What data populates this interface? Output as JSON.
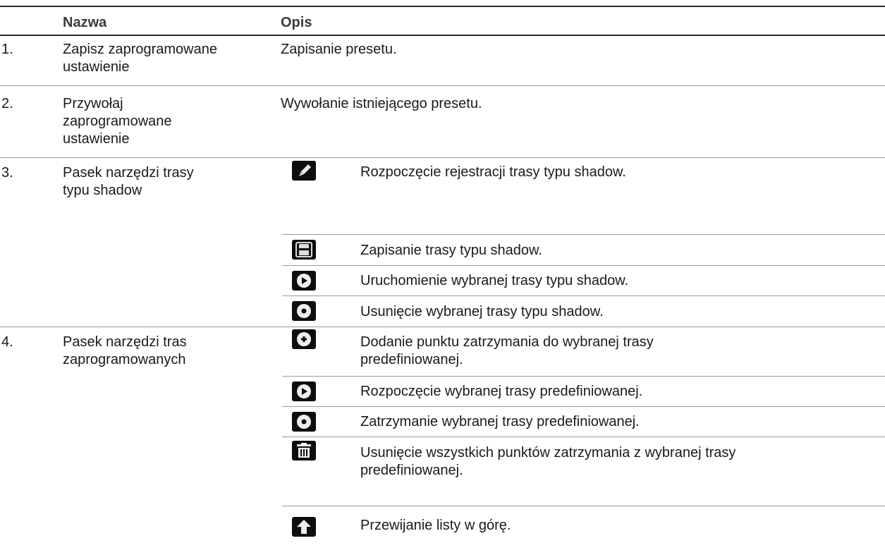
{
  "header": {
    "col_name": "Nazwa",
    "col_desc": "Opis"
  },
  "rows": [
    {
      "num": "1.",
      "name": [
        "Zapisz zaprogramowane",
        "ustawienie"
      ],
      "desc": "Zapisanie presetu."
    },
    {
      "num": "2.",
      "name": [
        "Przywołaj",
        "zaprogramowane",
        "ustawienie"
      ],
      "desc": "Wywołanie istniejącego presetu."
    },
    {
      "num": "3.",
      "name": [
        "Pasek narzędzi trasy",
        "typu shadow"
      ],
      "items": [
        {
          "icon": "pencil-icon",
          "desc": [
            "Rozpoczęcie rejestracji trasy typu shadow."
          ]
        },
        {
          "icon": "save-icon",
          "desc": [
            "Zapisanie trasy typu shadow."
          ]
        },
        {
          "icon": "play-icon",
          "desc": [
            "Uruchomienie wybranej trasy typu shadow."
          ]
        },
        {
          "icon": "stop-icon",
          "desc": [
            "Usunięcie wybranej trasy typu shadow."
          ]
        }
      ]
    },
    {
      "num": "4.",
      "name": [
        "Pasek narzędzi tras",
        "zaprogramowanych"
      ],
      "items": [
        {
          "icon": "add-point-icon",
          "desc": [
            "Dodanie punktu zatrzymania do wybranej trasy",
            "predefiniowanej."
          ]
        },
        {
          "icon": "play-icon",
          "desc": [
            "Rozpoczęcie wybranej trasy predefiniowanej."
          ]
        },
        {
          "icon": "stop-icon",
          "desc": [
            "Zatrzymanie wybranej trasy predefiniowanej."
          ]
        },
        {
          "icon": "trash-icon",
          "desc": [
            "Usunięcie wszystkich punktów zatrzymania z wybranej trasy",
            "predefiniowanej."
          ]
        },
        {
          "icon": "up-arrow-icon",
          "desc": [
            "Przewijanie listy w górę."
          ]
        }
      ]
    }
  ]
}
